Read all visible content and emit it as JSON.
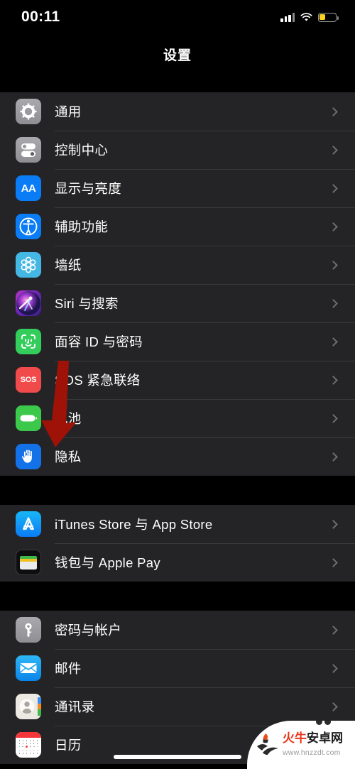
{
  "status_bar": {
    "time": "00:11",
    "signal_icon": "cellular-signal-icon",
    "wifi_icon": "wifi-icon",
    "battery_icon": "battery-low-power-icon",
    "battery_color": "#f9d11e"
  },
  "navbar": {
    "title": "设置"
  },
  "groups": [
    {
      "rows": [
        {
          "label": "通用",
          "icon": "gear-icon",
          "icon_class": "ic-gear"
        },
        {
          "label": "控制中心",
          "icon": "control-center-icon",
          "icon_class": "ic-control"
        },
        {
          "label": "显示与亮度",
          "icon": "display-aa-icon",
          "icon_class": "ic-display"
        },
        {
          "label": "辅助功能",
          "icon": "accessibility-icon",
          "icon_class": "ic-access"
        },
        {
          "label": "墙纸",
          "icon": "wallpaper-icon",
          "icon_class": "ic-wall"
        },
        {
          "label": "Siri 与搜索",
          "icon": "siri-icon",
          "icon_class": "ic-siri"
        },
        {
          "label": "面容 ID 与密码",
          "icon": "face-id-icon",
          "icon_class": "ic-faceid"
        },
        {
          "label": "SOS 紧急联络",
          "icon": "sos-icon",
          "icon_class": "ic-sos"
        },
        {
          "label": "电池",
          "icon": "battery-icon",
          "icon_class": "ic-battery"
        },
        {
          "label": "隐私",
          "icon": "privacy-hand-icon",
          "icon_class": "ic-privacy"
        }
      ]
    },
    {
      "rows": [
        {
          "label": "iTunes Store 与 App Store",
          "icon": "app-store-icon",
          "icon_class": "ic-appstore"
        },
        {
          "label": "钱包与 Apple Pay",
          "icon": "wallet-icon",
          "icon_class": "ic-wallet"
        }
      ]
    },
    {
      "rows": [
        {
          "label": "密码与帐户",
          "icon": "key-icon",
          "icon_class": "ic-key"
        },
        {
          "label": "邮件",
          "icon": "mail-icon",
          "icon_class": "ic-mail"
        },
        {
          "label": "通讯录",
          "icon": "contacts-icon",
          "icon_class": "ic-contacts"
        },
        {
          "label": "日历",
          "icon": "calendar-icon",
          "icon_class": "ic-calendar"
        }
      ]
    }
  ],
  "annotation": {
    "type": "arrow",
    "color": "#9e1208",
    "points_from": "SOS 紧急联络",
    "points_to": "隐私"
  },
  "watermark": {
    "logo": "panda-torch-logo",
    "brand_red": "火牛",
    "brand_black": "安卓网",
    "url": "www.hnzzdt.com"
  }
}
